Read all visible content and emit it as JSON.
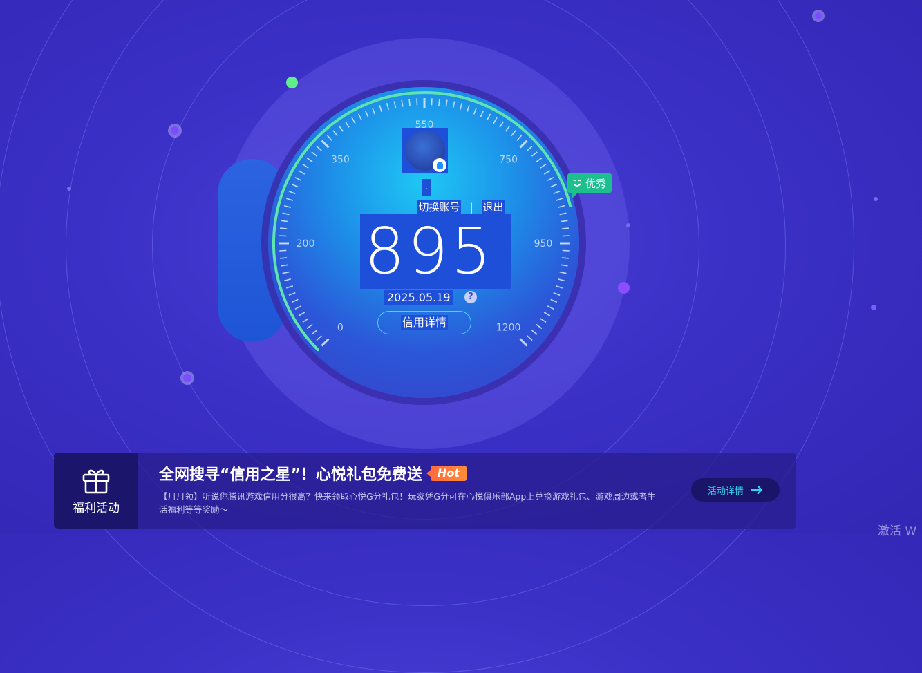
{
  "gauge": {
    "ticks": [
      "0",
      "200",
      "350",
      "550",
      "750",
      "950",
      "1200"
    ],
    "score": "895",
    "date": "2025.05.19",
    "rating": "优秀",
    "fraction_filled": 0.78
  },
  "account": {
    "nickname": ".",
    "switch_label": "切换账号",
    "separator": "|",
    "logout_label": "退出"
  },
  "buttons": {
    "credit_detail": "信用详情",
    "help": "?"
  },
  "banner": {
    "section_label": "福利活动",
    "title": "全网搜寻“信用之星”！心悦礼包免费送",
    "hot": "Hot",
    "description": "【月月领】听说你腾讯游戏信用分很高？快来领取心悦G分礼包！玩家凭G分可在心悦俱乐部App上兑换游戏礼包、游戏周边或者生活福利等等奖励～",
    "action_label": "活动详情"
  },
  "watermark": "激活 W",
  "colors": {
    "accent_cyan": "#33d7f3",
    "rating_green": "#1ebf8f",
    "hot_orange": "#ff6a3d",
    "arc_green": "#5fe3b0"
  }
}
